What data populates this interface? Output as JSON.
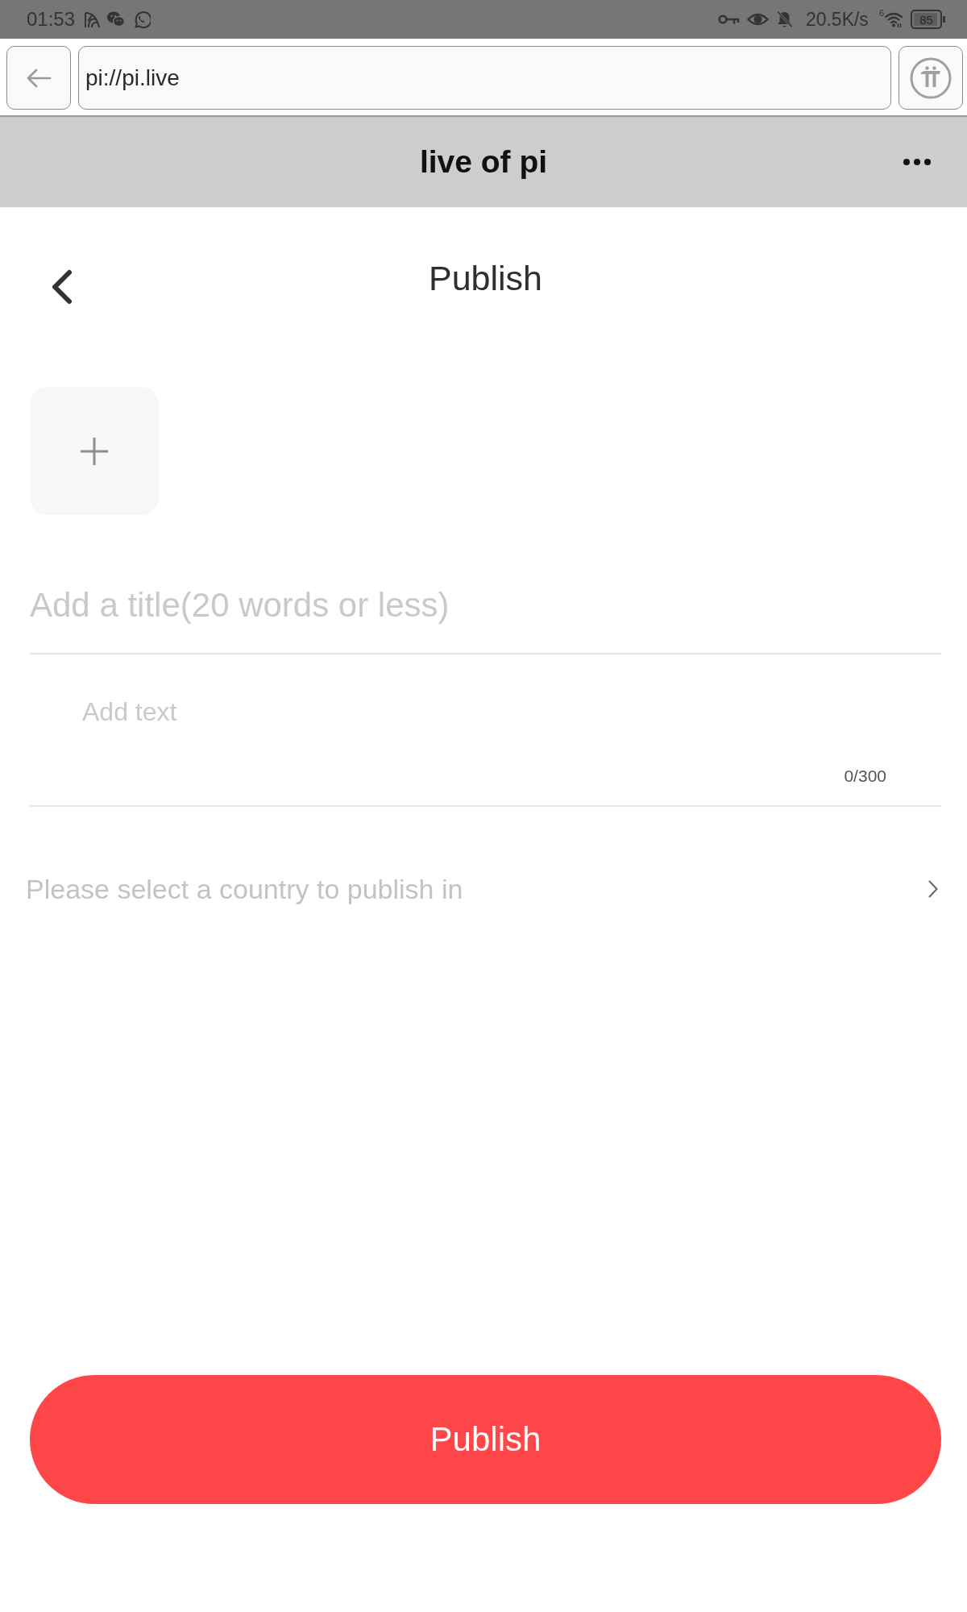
{
  "status_bar": {
    "time": "01:53",
    "network_speed": "20.5K/s",
    "wifi_standard": "6",
    "battery": "85"
  },
  "browser": {
    "url": "pi://pi.live"
  },
  "app_header": {
    "title": "live of pi"
  },
  "page": {
    "title": "Publish"
  },
  "form": {
    "title_field": {
      "placeholder": "Add a title(20 words or less)"
    },
    "text_field": {
      "placeholder": "Add text",
      "counter": "0/300"
    },
    "country_picker": {
      "prompt": "Please select a country to publish in"
    }
  },
  "publish_button": {
    "label": "Publish"
  }
}
